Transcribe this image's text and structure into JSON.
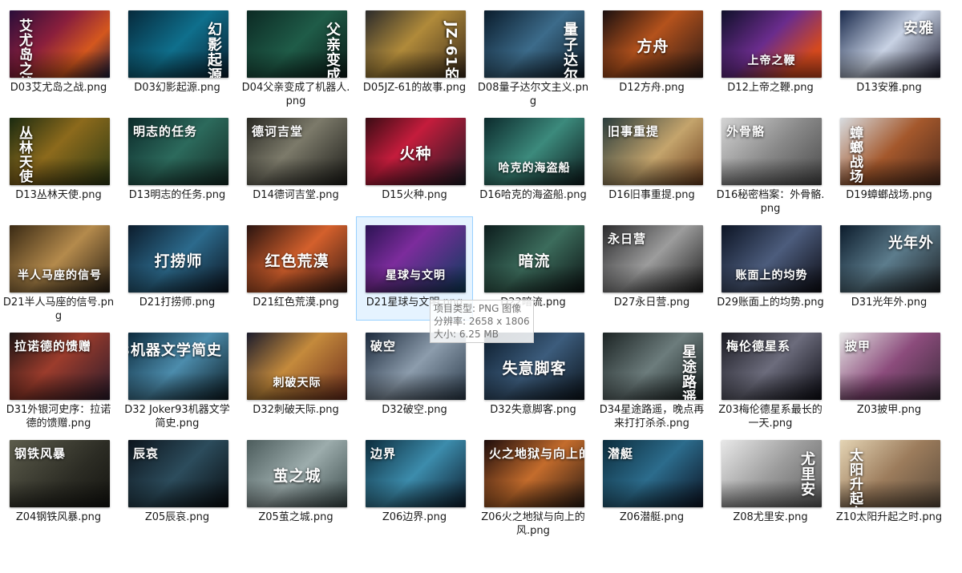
{
  "files": [
    {
      "label": "D03艾尤岛之战.png",
      "title": "艾尤岛之战",
      "pos": "left",
      "bg": "linear-gradient(135deg,#2a0d3a,#8a1f3c 40%,#d4571e 70%,#1b1b3a)"
    },
    {
      "label": "D03幻影起源.png",
      "title": "幻影起源",
      "pos": "right",
      "bg": "linear-gradient(135deg,#062a3c,#0f6f8c 50%,#0a1e2e)"
    },
    {
      "label": "D04父亲变成了机器人.png",
      "title": "父亲变成了机器人",
      "pos": "right",
      "bg": "linear-gradient(135deg,#0c2a24,#1f5c48 50%,#0a1a16)"
    },
    {
      "label": "D05JZ-61的故事.png",
      "title": "JZ-61的故事",
      "pos": "right",
      "bg": "linear-gradient(135deg,#2b2b2b,#b08a3a 45%,#3a2a1a)"
    },
    {
      "label": "D08量子达尔文主义.png",
      "title": "量子达尔文主义",
      "pos": "right",
      "bg": "linear-gradient(135deg,#0a1c2c,#3c6b8a 50%,#0c1824)"
    },
    {
      "label": "D12方舟.png",
      "title": "方舟",
      "pos": "center",
      "bg": "linear-gradient(135deg,#1b1010,#b4521c 45%,#2a1a16)"
    },
    {
      "label": "D12上帝之鞭.png",
      "title": "上帝之鞭",
      "pos": "bottom",
      "bg": "linear-gradient(135deg,#10102a,#6a2c8c 45%,#d4491e 80%)"
    },
    {
      "label": "D13安雅.png",
      "title": "安雅",
      "pos": "topright",
      "bg": "linear-gradient(135deg,#1a2a4c,#c8d2e4 50%,#1a1a2c)"
    },
    {
      "label": "D13丛林天使.png",
      "title": "丛林天使",
      "pos": "left",
      "bg": "linear-gradient(135deg,#1a2a10,#8c6a1c 45%,#2c3a14)"
    },
    {
      "label": "D13明志的任务.png",
      "title": "明志的任务",
      "pos": "topleft",
      "bg": "linear-gradient(135deg,#0c2a2a,#2c6a5c 50%,#142a24)"
    },
    {
      "label": "D14德诃吉堂.png",
      "title": "德诃吉堂",
      "pos": "topleft",
      "bg": "linear-gradient(135deg,#2a2a24,#7c7a6a 45%,#1c1c18)"
    },
    {
      "label": "D15火种.png",
      "title": "火种",
      "pos": "center",
      "bg": "linear-gradient(135deg,#3a0c14,#c41c3c 40%,#1a1a24)"
    },
    {
      "label": "D16哈克的海盗船.png",
      "title": "哈克的海盗船",
      "pos": "bottom",
      "bg": "linear-gradient(135deg,#0c2a2c,#3c8a7c 50%,#0c1a1c)"
    },
    {
      "label": "D16旧事重提.png",
      "title": "旧事重提",
      "pos": "topleft",
      "bg": "linear-gradient(135deg,#2a3c3c,#c4a46c 55%,#6a3c1c)"
    },
    {
      "label": "D16秘密档案：外骨骼.png",
      "title": "外骨骼",
      "pos": "topleft",
      "bg": "linear-gradient(135deg,#d4d4d4,#8a8a8a 50%,#4a4a4a)"
    },
    {
      "label": "D19蟑螂战场.png",
      "title": "蟑螂战场",
      "pos": "left",
      "bg": "linear-gradient(135deg,#d8dce0,#a4582c 50%,#4c2a1c)"
    },
    {
      "label": "D21半人马座的信号.png",
      "title": "半人马座的信号",
      "pos": "bottom",
      "bg": "linear-gradient(135deg,#3a2a14,#b48a4c 50%,#2a2014)"
    },
    {
      "label": "D21打捞师.png",
      "title": "打捞师",
      "pos": "center",
      "bg": "linear-gradient(135deg,#0c1c2c,#2c6a8c 50%,#0c1420)"
    },
    {
      "label": "D21红色荒漠.png",
      "title": "红色荒漠",
      "pos": "center",
      "bg": "linear-gradient(135deg,#2a1410,#d4602c 50%,#3a1c14)"
    },
    {
      "label": "D21星球与文明.png",
      "title": "星球与文明",
      "pos": "bottom",
      "bg": "linear-gradient(135deg,#2c1454,#7c2c9c 40%,#0c3c5c)"
    },
    {
      "label": "D22暗流.png",
      "title": "暗流",
      "pos": "center",
      "bg": "linear-gradient(135deg,#0c1c1c,#3c6c5c 50%,#0c1414)"
    },
    {
      "label": "D27永日营.png",
      "title": "永日营",
      "pos": "topleft",
      "bg": "linear-gradient(135deg,#2a2a2c,#9c9c9c 50%,#1c1c1c)"
    },
    {
      "label": "D29账面上的均势.png",
      "title": "账面上的均势",
      "pos": "bottom",
      "bg": "linear-gradient(135deg,#0c1424,#4c5c7c 50%,#0c0c14)"
    },
    {
      "label": "D31光年外.png",
      "title": "光年外",
      "pos": "topright",
      "bg": "linear-gradient(135deg,#0c1c2c,#5c7c8c 50%,#1c2024)"
    },
    {
      "label": "D31外银河史序：拉诺德的馈赠.png",
      "title": "拉诺德的馈赠",
      "pos": "topleft",
      "bg": "linear-gradient(135deg,#1c1414,#9c3c2c 45%,#2c1c2c)"
    },
    {
      "label": "D32 Joker93机器文学简史.png",
      "title": "Joker93机器文学简史",
      "pos": "topright",
      "bg": "linear-gradient(135deg,#0c2a3c,#4c8cac 50%,#0c1c24)"
    },
    {
      "label": "D32刺破天际.png",
      "title": "刺破天际",
      "pos": "bottom",
      "bg": "linear-gradient(135deg,#1c1c2c,#c48a3c 45%,#6c2c1c)"
    },
    {
      "label": "D32破空.png",
      "title": "破空",
      "pos": "topleft",
      "bg": "linear-gradient(135deg,#1c2a3c,#8c9cac 50%,#2c3c4c)"
    },
    {
      "label": "D32失意脚客.png",
      "title": "失意脚客",
      "pos": "center",
      "bg": "linear-gradient(135deg,#0c1c2c,#3c5c7c 50%,#0c141c)"
    },
    {
      "label": "D34星途路遥，晚点再来打打杀杀.png",
      "title": "星途路遥",
      "pos": "right",
      "bg": "linear-gradient(135deg,#1c2424,#6c7c7c 50%,#141c1c)"
    },
    {
      "label": "Z03梅伦德星系最长的一天.png",
      "title": "梅伦德星系",
      "pos": "topleft",
      "bg": "linear-gradient(135deg,#1c1c24,#6c6c7c 50%,#0c0c14)"
    },
    {
      "label": "Z03披甲.png",
      "title": "披甲",
      "pos": "topleft",
      "bg": "linear-gradient(135deg,#e4e4e4,#8c4c7c 50%,#3c2c3c)"
    },
    {
      "label": "Z04钢铁风暴.png",
      "title": "钢铁风暴",
      "pos": "topleft",
      "bg": "linear-gradient(135deg,#5c5c4c,#2c2c24 60%,#141410)"
    },
    {
      "label": "Z05辰哀.png",
      "title": "辰哀",
      "pos": "topleft",
      "bg": "linear-gradient(135deg,#0c141c,#2c4c5c 50%,#080c10)"
    },
    {
      "label": "Z05茧之城.png",
      "title": "茧之城",
      "pos": "center",
      "bg": "linear-gradient(135deg,#4c5c5c,#9cacac 50%,#3c4c4c)"
    },
    {
      "label": "Z06边界.png",
      "title": "边界",
      "pos": "topleft",
      "bg": "linear-gradient(135deg,#0c2c3c,#3c8cac 50%,#0c1c2c)"
    },
    {
      "label": "Z06火之地狱与向上的风.png",
      "title": "火之地狱与向上的风",
      "pos": "topleft",
      "bg": "linear-gradient(135deg,#1c0c0c,#c46c2c 50%,#2c1c14)"
    },
    {
      "label": "Z06潜艇.png",
      "title": "潜艇",
      "pos": "topleft",
      "bg": "linear-gradient(135deg,#0c2c3c,#2c6c8c 50%,#0c1424)"
    },
    {
      "label": "Z08尤里安.png",
      "title": "尤里安",
      "pos": "right",
      "bg": "linear-gradient(135deg,#e8e8e8,#9c9c9c 50%,#5c5c5c)"
    },
    {
      "label": "Z10太阳升起之时.png",
      "title": "太阳升起之时",
      "pos": "left",
      "bg": "linear-gradient(135deg,#e4d4b4,#9c7c5c 50%,#5c4c3c)"
    }
  ],
  "tooltip": {
    "type_line": "项目类型: PNG 图像",
    "resolution_line": "分辨率: 2658 x 1806",
    "size_line": "大小: 6.25 MB"
  }
}
